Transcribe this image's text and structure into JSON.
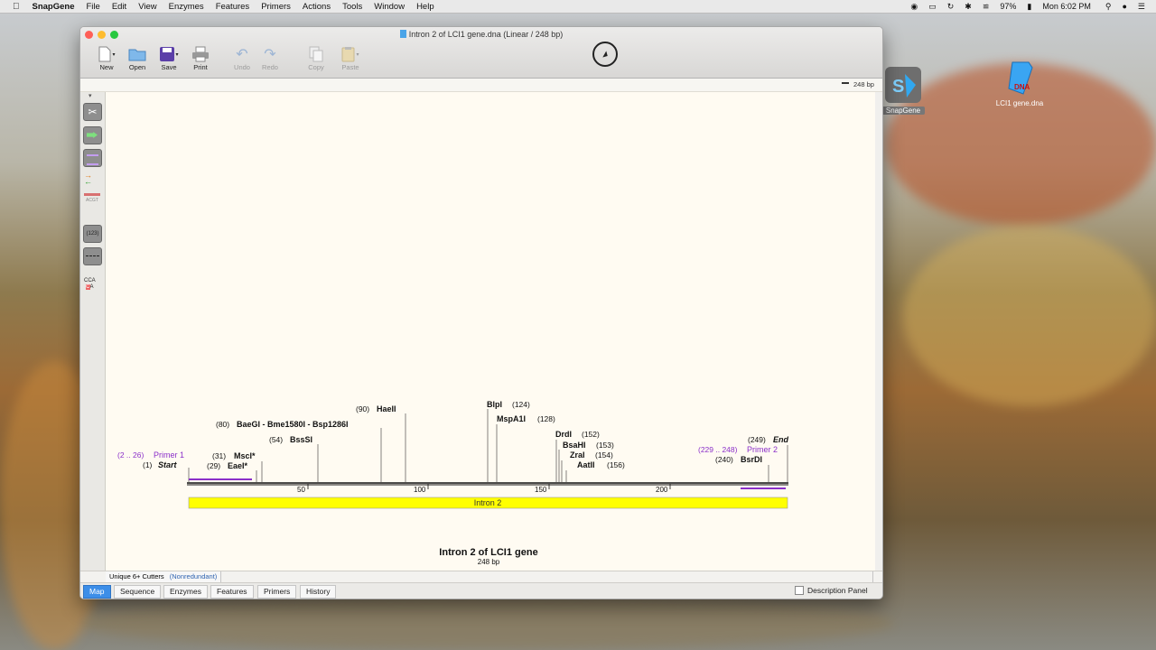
{
  "menubar": {
    "app": "SnapGene",
    "items": [
      "File",
      "Edit",
      "View",
      "Enzymes",
      "Features",
      "Primers",
      "Actions",
      "Tools",
      "Window",
      "Help"
    ],
    "battery": "97%",
    "clock": "Mon 6:02 PM"
  },
  "desktop": {
    "icons": [
      {
        "label": "SnapGene"
      },
      {
        "label": "LCI1 gene.dna"
      }
    ]
  },
  "window": {
    "title": "Intron 2 of LCI1 gene.dna  (Linear / 248 bp)",
    "toolbar": {
      "new": "New",
      "open": "Open",
      "save": "Save",
      "print": "Print",
      "undo": "Undo",
      "redo": "Redo",
      "copy": "Copy",
      "paste": "Paste"
    },
    "length_readout": "248 bp",
    "map": {
      "title": "Intron 2 of LCI1 gene",
      "subtitle": "248 bp",
      "feature": "Intron 2",
      "ticks": [
        "50",
        "100",
        "150",
        "200"
      ],
      "labels": [
        {
          "pos": "(1)",
          "name": "Start"
        },
        {
          "pos": "(2 .. 26)",
          "name": "Primer 1"
        },
        {
          "pos": "(29)",
          "name": "EaeI*"
        },
        {
          "pos": "(31)",
          "name": "MscI*"
        },
        {
          "pos": "(54)",
          "name": "BssSI"
        },
        {
          "pos": "(80)",
          "name": "BaeGI - Bme1580I - Bsp1286I"
        },
        {
          "pos": "(90)",
          "name": "HaeII"
        },
        {
          "pos": "(124)",
          "name": "BlpI"
        },
        {
          "pos": "(128)",
          "name": "MspA1I"
        },
        {
          "pos": "(152)",
          "name": "DrdI"
        },
        {
          "pos": "(153)",
          "name": "BsaHI"
        },
        {
          "pos": "(154)",
          "name": "ZraI"
        },
        {
          "pos": "(156)",
          "name": "AatII"
        },
        {
          "pos": "(240)",
          "name": "BsrDI"
        },
        {
          "pos": "(229 .. 248)",
          "name": "Primer 2"
        },
        {
          "pos": "(249)",
          "name": "End"
        }
      ]
    },
    "filter": {
      "label": "Unique 6+ Cutters",
      "mode": "(Nonredundant)"
    },
    "tabs": [
      "Map",
      "Sequence",
      "Enzymes",
      "Features",
      "Primers",
      "History"
    ],
    "description_panel": "Description Panel"
  },
  "colors": {
    "feature": "#ffff00",
    "primer": "#8b2fc9",
    "accent": "#3c8ee8"
  }
}
